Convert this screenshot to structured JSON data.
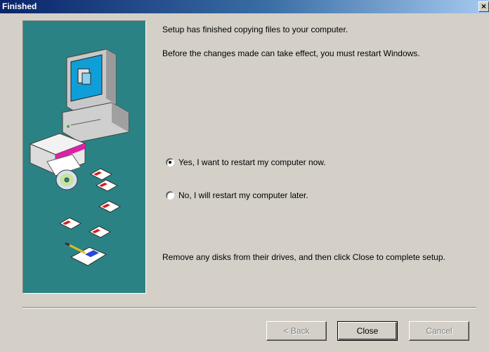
{
  "window": {
    "title": "Finished",
    "close_glyph": "×",
    "close_icon": "close-icon"
  },
  "messages": {
    "line1": "Setup has finished copying files to your computer.",
    "line2": "Before the changes made can take effect, you must restart Windows.",
    "line3": "Remove any disks from their drives, and then click Close to complete setup."
  },
  "options": {
    "restart_now": {
      "label": "Yes, I want to restart my computer now.",
      "selected": true
    },
    "restart_later": {
      "label": "No, I will restart my computer later.",
      "selected": false
    }
  },
  "buttons": {
    "back": {
      "label": "< Back",
      "enabled": false
    },
    "close": {
      "label": "Close",
      "enabled": true
    },
    "cancel": {
      "label": "Cancel",
      "enabled": false
    }
  },
  "colors": {
    "title_gradient_start": "#0a246a",
    "title_gradient_end": "#a6caf0",
    "art_background": "#2b8284",
    "dialog_face": "#d4d0c8"
  }
}
